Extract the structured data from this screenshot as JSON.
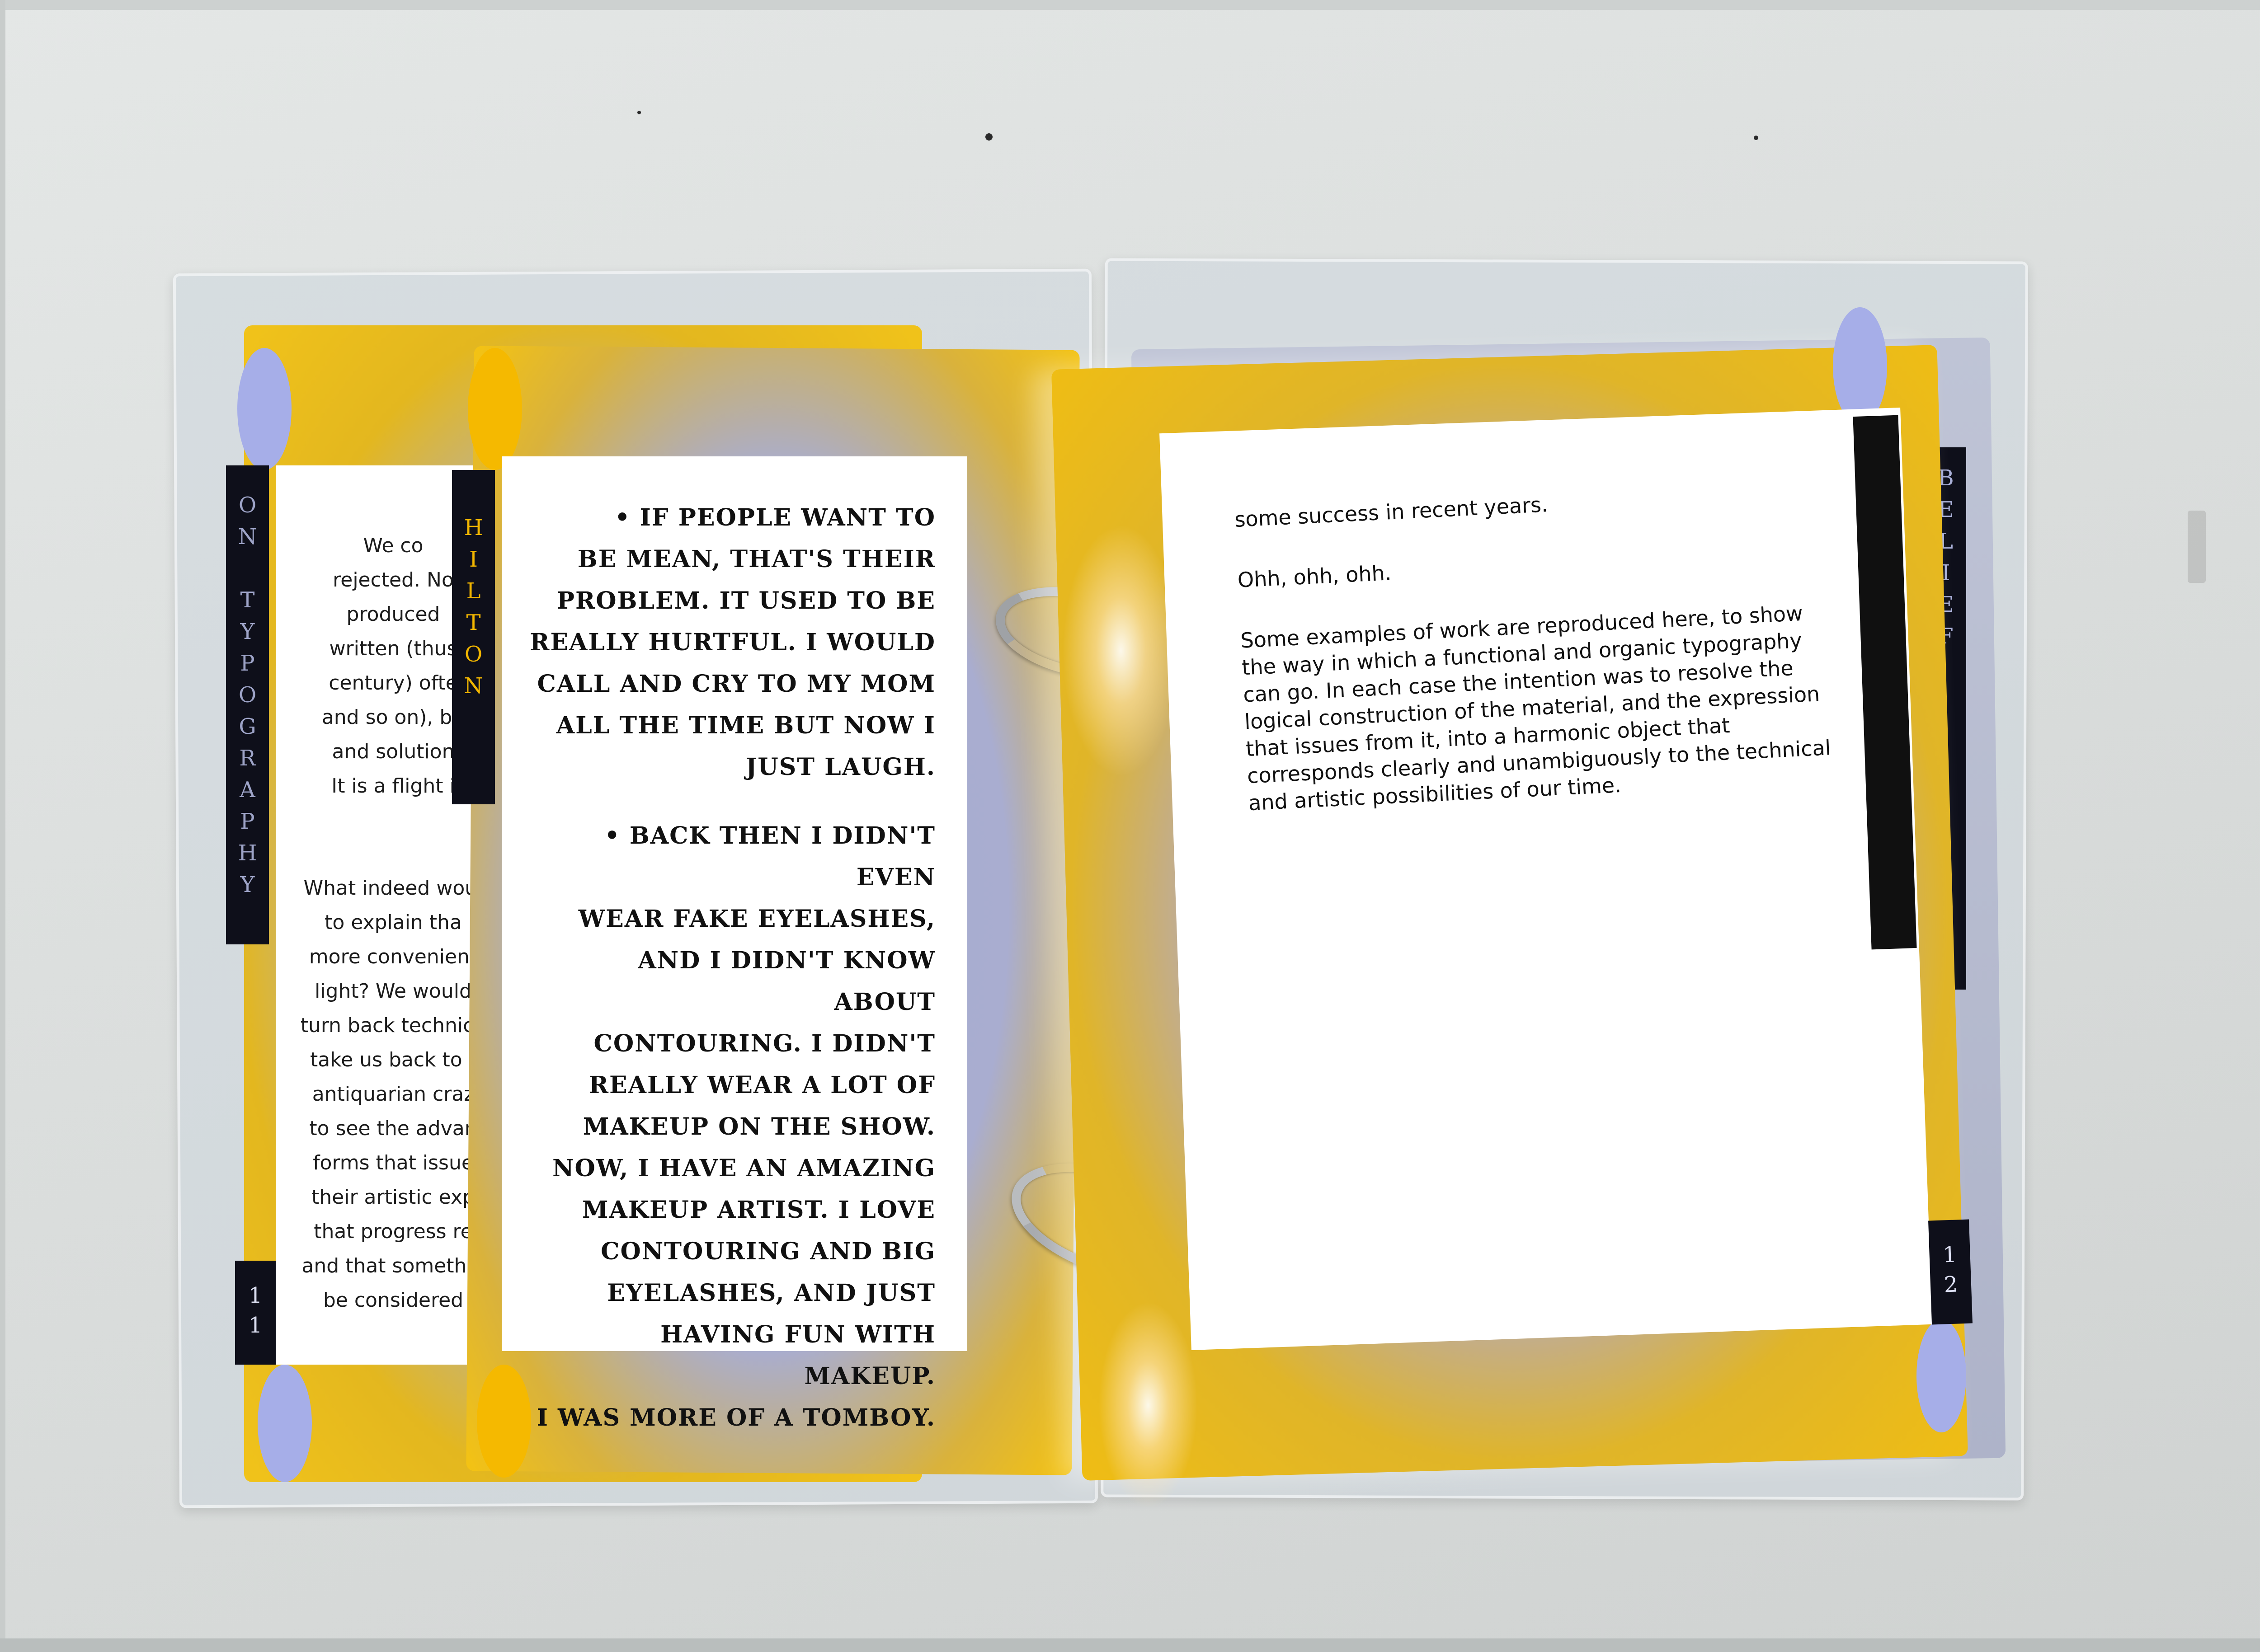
{
  "left_back_page": {
    "tab_label": "ON TYPOGRAPHY",
    "page_number": "11",
    "paragraphs": [
      "We co\nrejected. No\nproduced\nwritten (thus\ncentury) ofte\nand so on), bu\nand solution\nIt is a flight i",
      "What indeed woul\nto explain tha\nmore convenient\nlight? We would\nturn back technica\ntake us back to t\nantiquarian craz\nto see the advan\nforms that issue\ntheir artistic exp\nthat progress re\nand that somethin\nbe considered"
    ]
  },
  "hilton_page": {
    "tab_label": "HILTON",
    "paragraphs": [
      "• IF PEOPLE WANT TO\nBE MEAN, THAT'S THEIR\nPROBLEM. IT USED TO BE\nREALLY HURTFUL. I WOULD\nCALL AND CRY TO MY MOM\nALL THE TIME BUT NOW I\nJUST LAUGH.",
      "• BACK THEN I DIDN'T EVEN\nWEAR FAKE EYELASHES,\nAND I DIDN'T KNOW ABOUT\nCONTOURING. I DIDN'T\nREALLY WEAR A LOT OF\nMAKEUP ON THE SHOW.\nNOW, I HAVE AN AMAZING\nMAKEUP ARTIST. I LOVE\nCONTOURING AND BIG\nEYELASHES, AND JUST\nHAVING FUN WITH MAKEUP.\nI WAS MORE OF A TOMBOY."
    ]
  },
  "right_page": {
    "tab_label": "BELIEF",
    "page_number": "12",
    "paragraphs": [
      "some success in recent years.",
      "Ohh, ohh, ohh.",
      "Some examples of work are reproduced here, to show\nthe  way in which a functional and organic typography\ncan go. In each case the intention was to resolve the\nlogical construction of the material, and the expression\nthat issues from it, into a harmonic object that\ncorresponds clearly and unambiguously to the technical\nand artistic possibilities of our time."
    ]
  },
  "colors": {
    "card_yellow": "#f1c31a",
    "card_lavender": "#a6aee8",
    "tab_navy": "#0e0f1a",
    "hilton_tab_text": "#f2b600"
  }
}
